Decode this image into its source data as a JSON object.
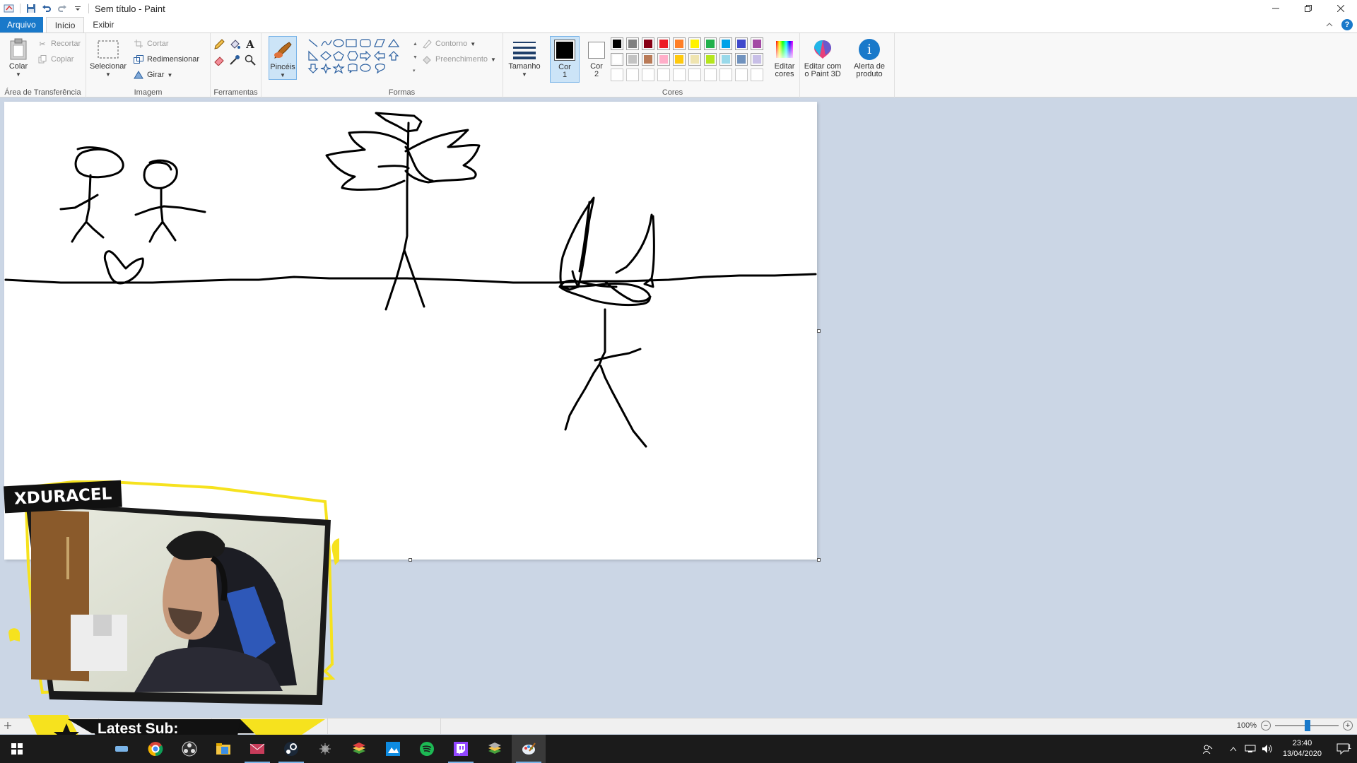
{
  "window": {
    "title": "Sem título - Paint"
  },
  "tabs": [
    "Arquivo",
    "Início",
    "Exibir"
  ],
  "ribbon": {
    "clipboard": {
      "paste": "Colar",
      "cut": "Recortar",
      "copy": "Copiar",
      "label": "Área de Transferência"
    },
    "image": {
      "select": "Selecionar",
      "crop": "Cortar",
      "resize": "Redimensionar",
      "rotate": "Girar",
      "label": "Imagem"
    },
    "tools": {
      "label": "Ferramentas",
      "brushes": "Pincéis"
    },
    "shapes": {
      "outline": "Contorno",
      "fill": "Preenchimento",
      "label": "Formas"
    },
    "size": "Tamanho",
    "color1": {
      "label": "Cor",
      "num": "1"
    },
    "color2": {
      "label": "Cor",
      "num": "2"
    },
    "colors": {
      "label": "Cores",
      "edit": [
        "Editar",
        "cores"
      ],
      "row1": [
        "#000000",
        "#7f7f7f",
        "#880015",
        "#ed1c24",
        "#ff7f27",
        "#fff200",
        "#22b14c",
        "#00a2e8",
        "#3f48cc",
        "#a349a4"
      ],
      "row2": [
        "#ffffff",
        "#c3c3c3",
        "#b97a57",
        "#ffaec9",
        "#ffc90e",
        "#efe4b0",
        "#b5e61d",
        "#99d9ea",
        "#7092be",
        "#c8bfe7"
      ]
    },
    "paint3d": [
      "Editar com",
      "o Paint 3D"
    ],
    "product_alert": [
      "Alerta de",
      "produto"
    ]
  },
  "overlay": {
    "streamer": "XDURACEL",
    "latest_sub": "Latest Sub:"
  },
  "status": {
    "zoom": "100%"
  },
  "taskbar": {
    "time": "23:40",
    "date": "13/04/2020",
    "notifications": "1"
  }
}
